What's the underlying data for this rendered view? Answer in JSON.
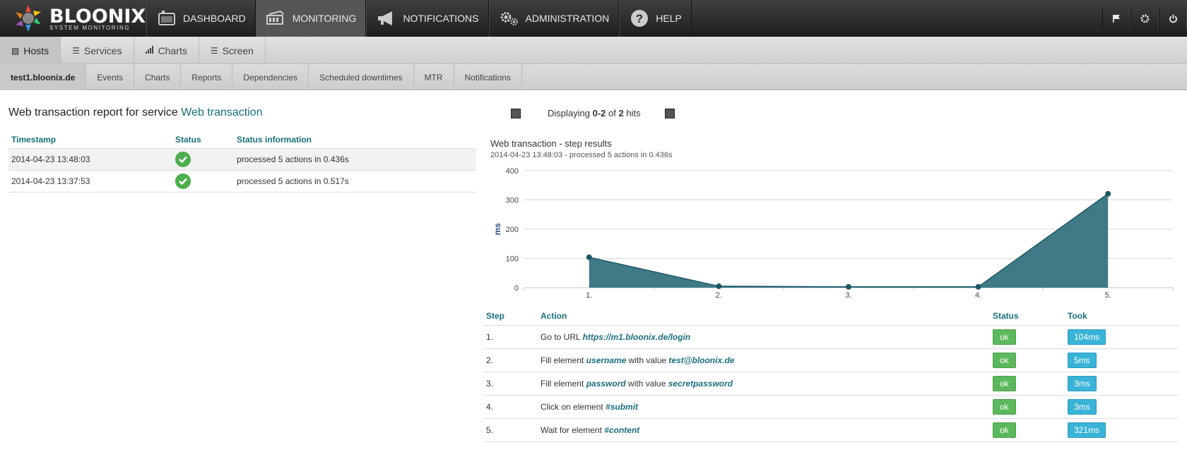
{
  "brand": {
    "name": "BLOONIX",
    "tagline": "SYSTEM MONITORING"
  },
  "topnav": [
    {
      "label": "DASHBOARD",
      "icon": "dashboard-icon"
    },
    {
      "label": "MONITORING",
      "icon": "monitoring-icon",
      "active": true
    },
    {
      "label": "NOTIFICATIONS",
      "icon": "megaphone-icon"
    },
    {
      "label": "ADMINISTRATION",
      "icon": "gears-icon"
    },
    {
      "label": "HELP",
      "icon": "help-icon"
    }
  ],
  "topright": [
    {
      "icon": "flag-icon"
    },
    {
      "icon": "gear-icon"
    },
    {
      "icon": "power-icon"
    }
  ],
  "subnav": [
    {
      "label": "Hosts",
      "icon": "hosts-icon",
      "active": true
    },
    {
      "label": "Services",
      "icon": "list-icon"
    },
    {
      "label": "Charts",
      "icon": "bar-chart-icon"
    },
    {
      "label": "Screen",
      "icon": "screen-icon"
    }
  ],
  "hostnav": [
    {
      "label": "test1.bloonix.de",
      "active": true
    },
    {
      "label": "Events"
    },
    {
      "label": "Charts"
    },
    {
      "label": "Reports"
    },
    {
      "label": "Dependencies"
    },
    {
      "label": "Scheduled downtimes"
    },
    {
      "label": "MTR"
    },
    {
      "label": "Notifications"
    }
  ],
  "report": {
    "title_prefix": "Web transaction report for service",
    "service_link": "Web transaction",
    "columns": [
      "Timestamp",
      "Status",
      "Status information"
    ],
    "rows": [
      {
        "timestamp": "2014-04-23 13:48:03",
        "status": "ok",
        "info": "processed 5 actions in 0.436s"
      },
      {
        "timestamp": "2014-04-23 13:37:53",
        "status": "ok",
        "info": "processed 5 actions in 0.517s"
      }
    ]
  },
  "pager": {
    "prefix": "Displaying",
    "range": "0-2",
    "of": "of",
    "total": "2",
    "suffix": "hits"
  },
  "chart_data": {
    "type": "area",
    "title": "Web transaction - step results",
    "subtitle": "2014-04-23 13:48:03 - processed 5 actions in 0.436s",
    "ylabel": "ms",
    "categories": [
      "1.",
      "2.",
      "3.",
      "4.",
      "5."
    ],
    "values": [
      104,
      5,
      3,
      3,
      321
    ],
    "ylim": [
      0,
      400
    ],
    "yticks": [
      0,
      100,
      200,
      300,
      400
    ],
    "grid": true,
    "color": "#2b6b7a"
  },
  "steps": {
    "columns": [
      "Step",
      "Action",
      "Status",
      "Took"
    ],
    "rows": [
      {
        "step": "1.",
        "parts": [
          {
            "t": "Go to URL "
          },
          {
            "b": "https://m1.bloonix.de/login"
          }
        ],
        "status": "ok",
        "took": "104ms"
      },
      {
        "step": "2.",
        "parts": [
          {
            "t": "Fill element "
          },
          {
            "b": "username"
          },
          {
            "t": " with value "
          },
          {
            "b": "test@bloonix.de"
          }
        ],
        "status": "ok",
        "took": "5ms"
      },
      {
        "step": "3.",
        "parts": [
          {
            "t": "Fill element "
          },
          {
            "b": "password"
          },
          {
            "t": " with value "
          },
          {
            "b": "secretpassword"
          }
        ],
        "status": "ok",
        "took": "3ms"
      },
      {
        "step": "4.",
        "parts": [
          {
            "t": "Click on element "
          },
          {
            "b": "#submit"
          }
        ],
        "status": "ok",
        "took": "3ms"
      },
      {
        "step": "5.",
        "parts": [
          {
            "t": "Wait for element "
          },
          {
            "b": "#content"
          }
        ],
        "status": "ok",
        "took": "321ms"
      }
    ]
  }
}
